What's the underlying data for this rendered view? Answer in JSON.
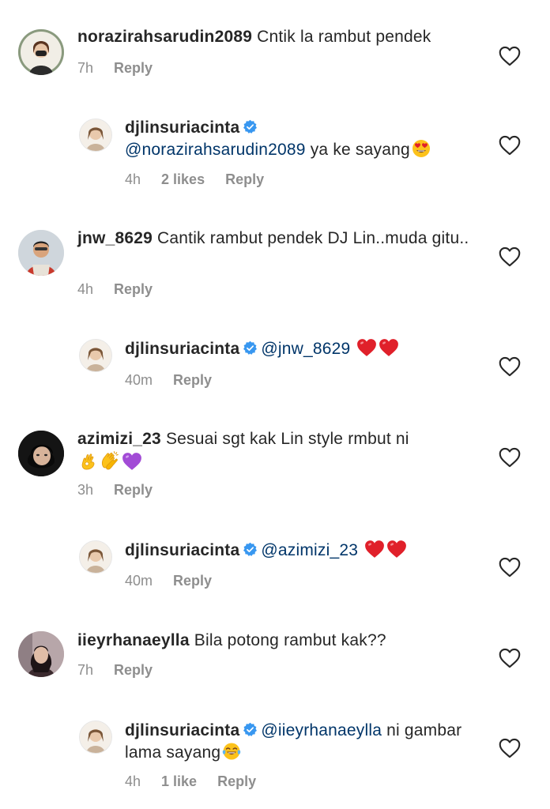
{
  "comments": [
    {
      "username": "norazirahsarudin2089",
      "text": " Cntik la rambut pendek",
      "time": "7h",
      "reply": "Reply"
    },
    {
      "username": "djlinsuriacinta",
      "mention": "@norazirahsarudin2089",
      "text": " ya ke sayang",
      "time": "4h",
      "likes": "2 likes",
      "reply": "Reply"
    },
    {
      "username": "jnw_8629",
      "text": " Cantik rambut pendek DJ Lin..muda gitu..",
      "time": "4h",
      "reply": "Reply"
    },
    {
      "username": "djlinsuriacinta",
      "mention": "@jnw_8629",
      "text": " ",
      "time": "40m",
      "reply": "Reply"
    },
    {
      "username": "azimizi_23",
      "text": " Sesuai sgt kak Lin style rmbut ni ",
      "time": "3h",
      "reply": "Reply"
    },
    {
      "username": "djlinsuriacinta",
      "mention": "@azimizi_23",
      "text": " ",
      "time": "40m",
      "reply": "Reply"
    },
    {
      "username": "iieyrhanaeylla",
      "text": " Bila potong rambut kak??",
      "time": "7h",
      "reply": "Reply"
    },
    {
      "username": "djlinsuriacinta",
      "mention": "@iieyrhanaeylla",
      "text": " ni gambar lama sayang",
      "time": "4h",
      "likes": "1 like",
      "reply": "Reply"
    }
  ],
  "icons": {
    "like": "heart-outline-icon",
    "verified": "verified-badge-icon",
    "emoji_heart_eyes": "heart-eyes-emoji",
    "emoji_red_heart": "red-heart-emoji",
    "emoji_ok_hand": "ok-hand-emoji",
    "emoji_clap": "clapping-hands-emoji",
    "emoji_purple_heart": "purple-heart-emoji",
    "emoji_tears_of_joy": "tears-of-joy-emoji"
  },
  "colors": {
    "text": "#262626",
    "meta": "#8e8e8e",
    "mention": "#003569",
    "verified": "#3897f0",
    "red_heart": "#e0202a",
    "purple_heart": "#a24bd6"
  }
}
